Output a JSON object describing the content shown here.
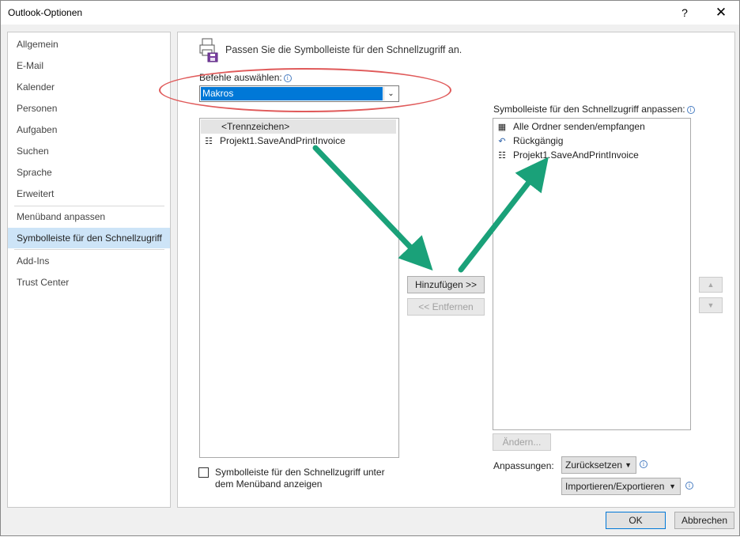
{
  "window": {
    "title": "Outlook-Optionen",
    "help_label": "?",
    "close_label": "✕"
  },
  "nav": {
    "items": [
      {
        "label": "Allgemein"
      },
      {
        "label": "E-Mail"
      },
      {
        "label": "Kalender"
      },
      {
        "label": "Personen"
      },
      {
        "label": "Aufgaben"
      },
      {
        "label": "Suchen"
      },
      {
        "label": "Sprache"
      },
      {
        "label": "Erweitert"
      },
      {
        "label": "Menüband anpassen"
      },
      {
        "label": "Symbolleiste für den Schnellzugriff"
      },
      {
        "label": "Add-Ins"
      },
      {
        "label": "Trust Center"
      }
    ],
    "selected": "Symbolleiste für den Schnellzugriff"
  },
  "main": {
    "heading": "Passen Sie die Symbolleiste für den Schnellzugriff an.",
    "choose_label": "Befehle auswählen:",
    "choose_value": "Makros",
    "left_list": [
      {
        "label": "<Trennzeichen>",
        "icon": "separator"
      },
      {
        "label": "Projekt1.SaveAndPrintInvoice",
        "icon": "macro-icon"
      }
    ],
    "right_label": "Symbolleiste für den Schnellzugriff anpassen:",
    "right_list": [
      {
        "label": "Alle Ordner senden/empfangen",
        "icon": "send-receive-icon"
      },
      {
        "label": "Rückgängig",
        "icon": "undo-icon"
      },
      {
        "label": "Projekt1.SaveAndPrintInvoice",
        "icon": "macro-icon"
      }
    ],
    "add_button": "Hinzufügen >>",
    "remove_button": "<< Entfernen",
    "modify_button": "Ändern...",
    "customizations_label": "Anpassungen:",
    "reset_button": "Zurücksetzen",
    "import_export_button": "Importieren/Exportieren",
    "checkbox_line1": "Symbolleiste für den Schnellzugriff unter",
    "checkbox_line2": "dem Menüband anzeigen",
    "up_label": "▲",
    "down_label": "▼"
  },
  "footer": {
    "ok_button": "OK",
    "cancel_button": "Abbrechen"
  },
  "colors": {
    "selection": "#0078d7",
    "nav_selected": "#cde4f7",
    "annotation_arrow": "#1aa179",
    "annotation_ellipse": "#e05a5a"
  }
}
